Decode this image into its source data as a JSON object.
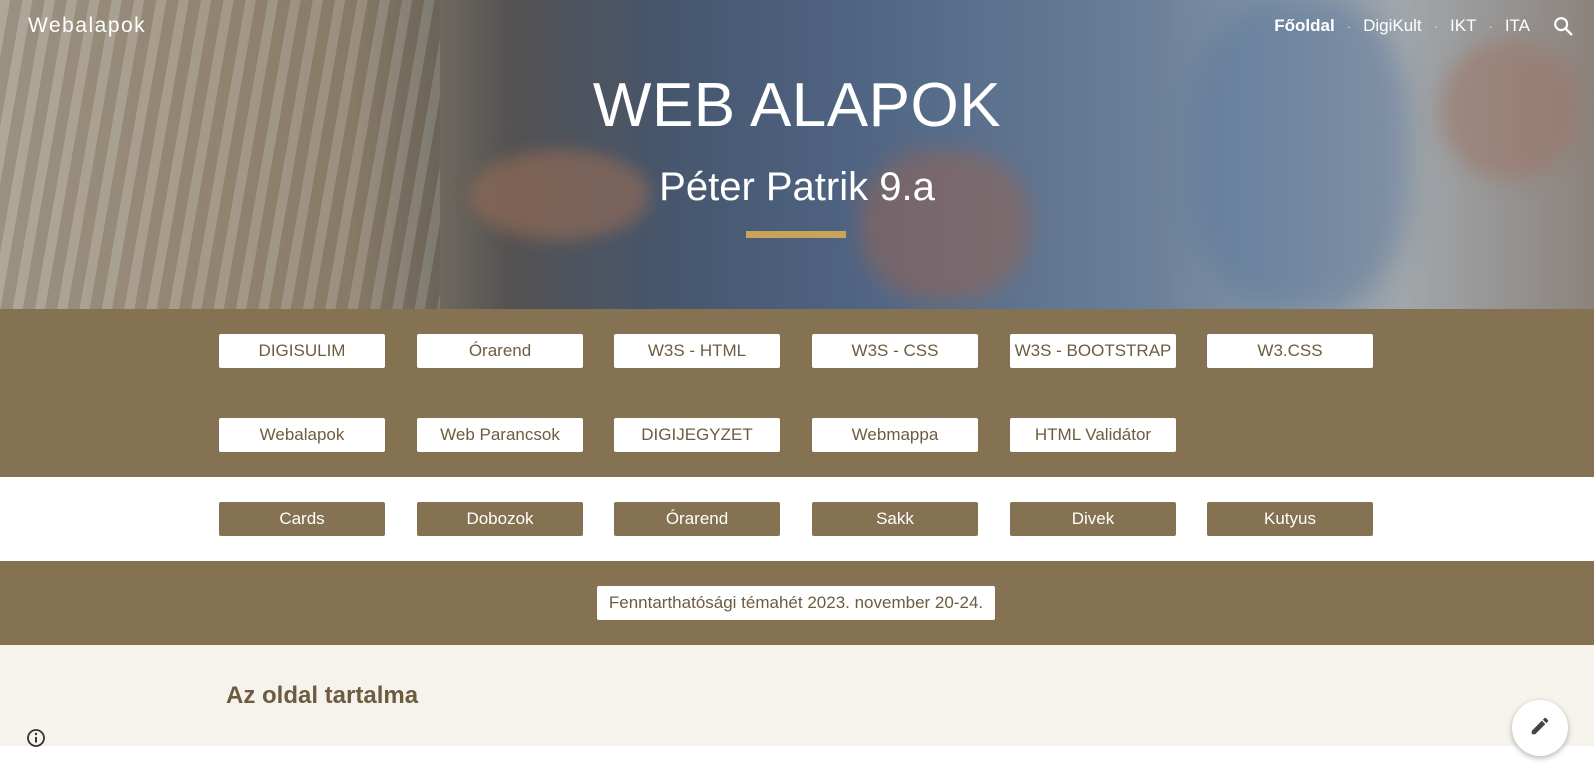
{
  "site": {
    "name": "Webalapok"
  },
  "nav": {
    "items": [
      {
        "label": "Főoldal",
        "active": true
      },
      {
        "label": "DigiKult",
        "active": false
      },
      {
        "label": "IKT",
        "active": false
      },
      {
        "label": "ITA",
        "active": false
      }
    ],
    "search_icon": "search-icon"
  },
  "hero": {
    "title": "WEB ALAPOK",
    "subtitle": "Péter Patrik 9.a",
    "accent_color": "#c9a35a"
  },
  "links_row1": [
    "DIGISULIM",
    "Órarend",
    "W3S - HTML",
    "W3S - CSS",
    "W3S - BOOTSTRAP",
    "W3.CSS"
  ],
  "links_row2": [
    "Webalapok",
    "Web Parancsok",
    "DIGIJEGYZET",
    "Webmappa",
    "HTML Validátor"
  ],
  "links_row3": [
    "Cards",
    "Dobozok",
    "Órarend",
    "Sakk",
    "Divek",
    "Kutyus"
  ],
  "banner": {
    "label": "Fenntarthatósági témahét 2023. november 20-24."
  },
  "content": {
    "title": "Az oldal tartalma"
  },
  "colors": {
    "brand_brown": "#857252",
    "text_brown": "#6d5c40",
    "cream": "#f6f3ec"
  },
  "icons": {
    "info": "info-icon",
    "edit": "edit-icon"
  }
}
